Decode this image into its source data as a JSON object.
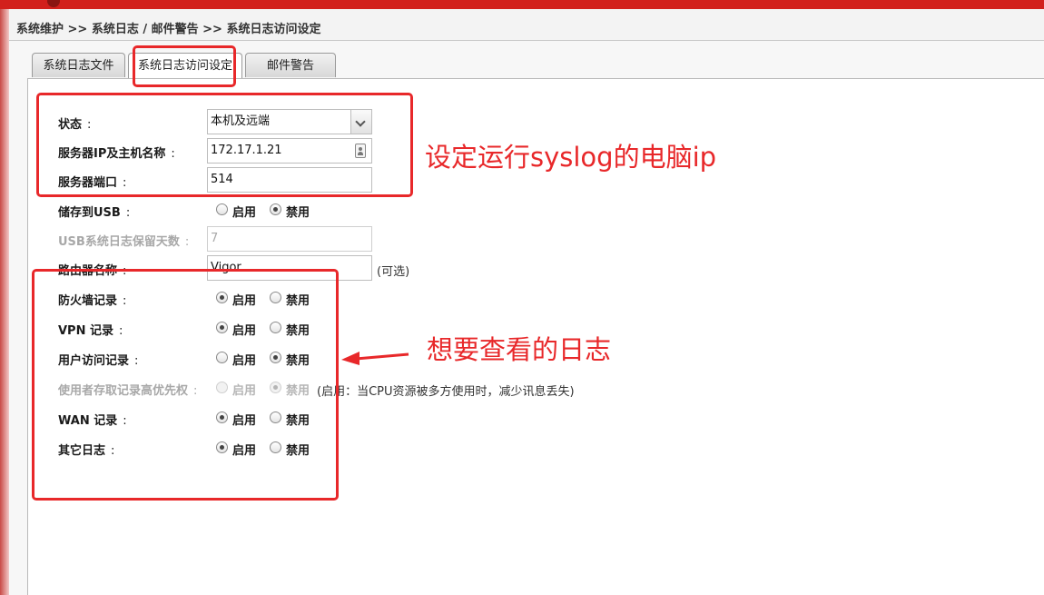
{
  "breadcrumb": "系统维护 >> 系统日志 / 邮件警告 >> 系统日志访问设定",
  "tabs": [
    "系统日志文件",
    "系统日志访问设定",
    "邮件警告"
  ],
  "form": {
    "status_label": "状态",
    "status_value": "本机及远端",
    "server_ip_label": "服务器IP及主机名称",
    "server_ip_value": "172.17.1.21",
    "server_port_label": "服务器端口",
    "server_port_value": "514",
    "usb_label": "储存到USB",
    "usb_days_label": "USB系统日志保留天数",
    "usb_days_value": "7",
    "router_name_label": "路由器名称",
    "router_name_value": "Vigor",
    "router_name_note": "(可选)",
    "enable_label": "启用",
    "disable_label": "禁用",
    "firewall_label": "防火墙记录",
    "vpn_label": "VPN 记录",
    "user_access_label": "用户访问记录",
    "priority_label": "使用者存取记录高优先权",
    "priority_note": "(启用：当CPU资源被多方使用时，减少讯息丢失)",
    "wan_label": "WAN 记录",
    "other_label": "其它日志"
  },
  "radio_state": {
    "usb": "disable",
    "firewall": "enable",
    "vpn": "enable",
    "user_access": "disable",
    "priority": "disable",
    "wan": "enable",
    "other": "enable"
  },
  "annotations": {
    "syslog_note": "设定运行syslog的电脑ip",
    "logs_note": "想要查看的日志"
  },
  "colors": {
    "top_bar": "#d2201c",
    "annotation_red": "#e8282a"
  }
}
